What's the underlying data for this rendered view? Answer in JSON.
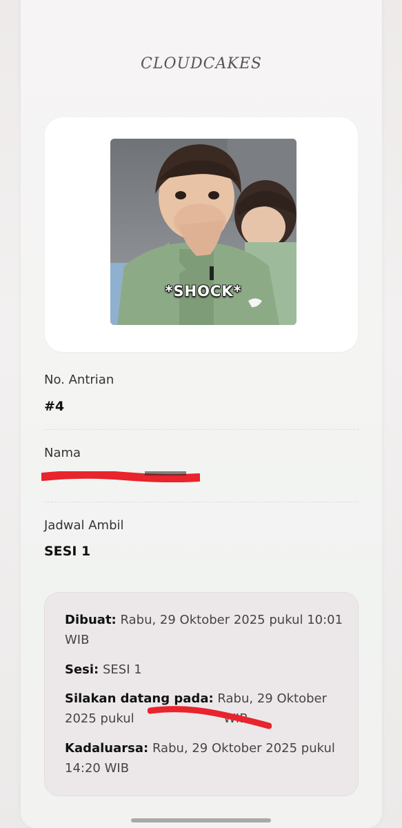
{
  "brand": "CLOUDCAKES",
  "photo": {
    "caption": "*SHOCK*"
  },
  "fields": {
    "queue_label": "No. Antrian",
    "queue_value": "#4",
    "name_label": "Nama",
    "schedule_label": "Jadwal Ambil",
    "schedule_value": "SESI 1"
  },
  "info": {
    "created_label": "Dibuat:",
    "created_value": "Rabu, 29 Oktober 2025 pukul 10:01 WIB",
    "session_label": "Sesi:",
    "session_value": "SESI 1",
    "arrive_label": "Silakan datang pada:",
    "arrive_value": "Rabu, 29 Oktober 2025 pukul",
    "arrive_tail": "WIB",
    "expire_label": "Kadaluarsa:",
    "expire_value": "Rabu, 29 Oktober 2025 pukul 14:20 WIB"
  },
  "colors": {
    "redaction": "#e8242c",
    "info_box": "#ece8e9"
  }
}
